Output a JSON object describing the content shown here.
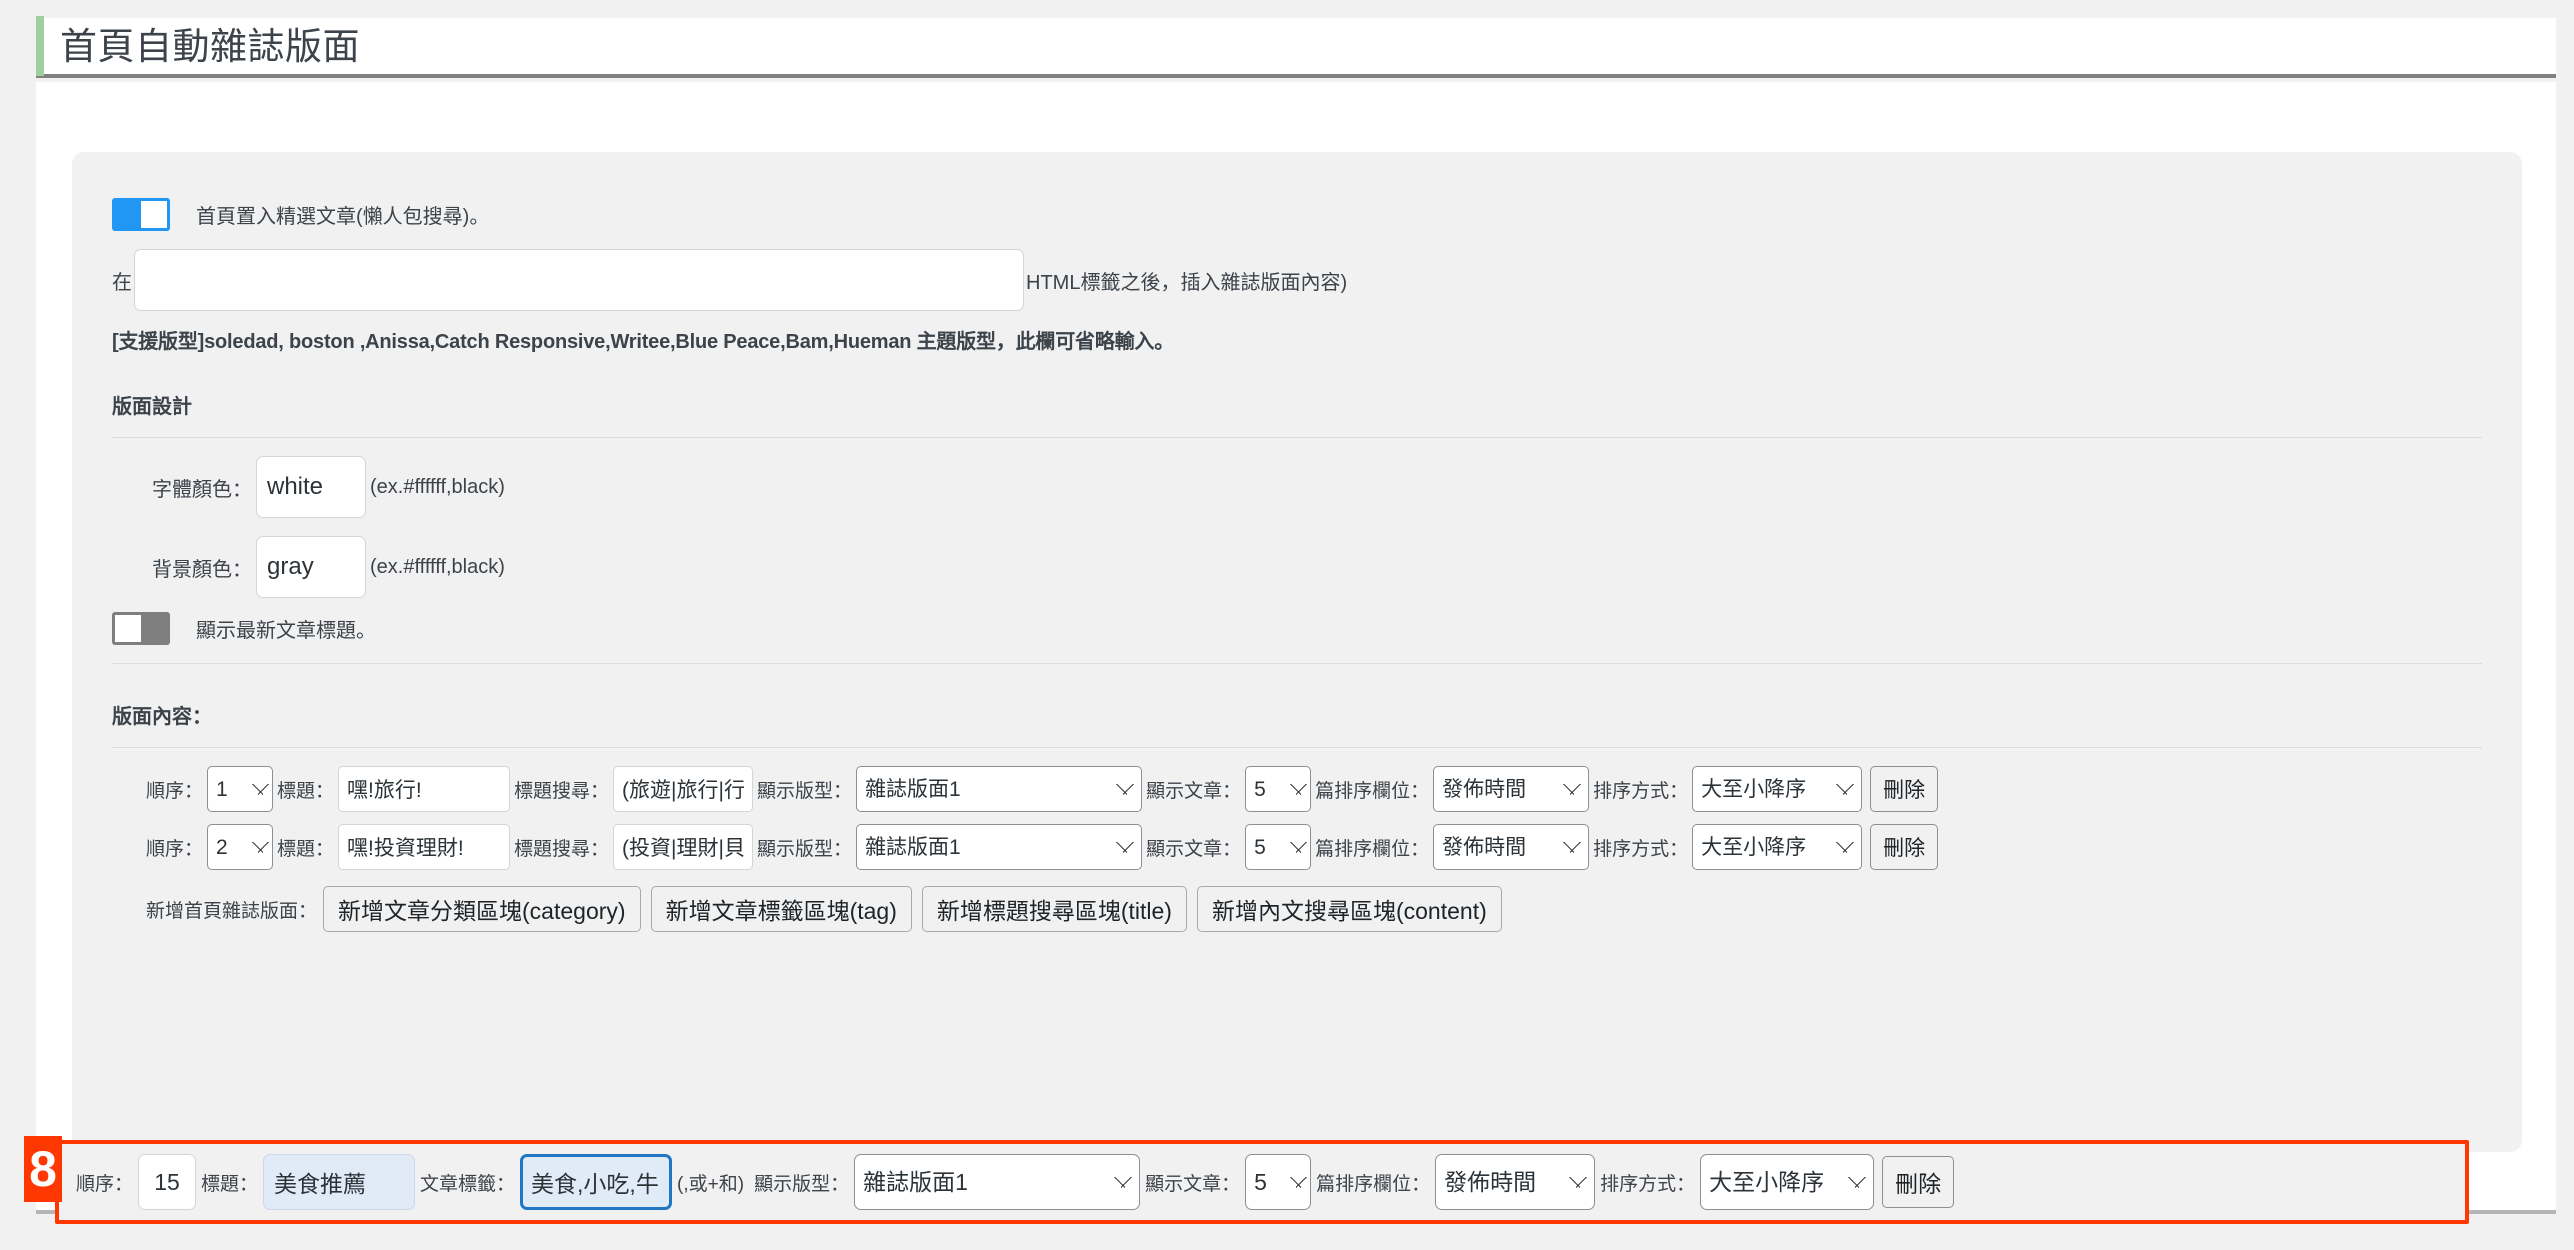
{
  "header": {
    "title": "首頁自動雜誌版面",
    "accent_color": "#9ed09e"
  },
  "featured": {
    "toggle_state": "on",
    "toggle_color": "#2196f3",
    "label": "首頁置入精選文章(懶人包搜尋)。",
    "prefix_text": "在",
    "html_tag_value": "",
    "html_tag_placeholder": "",
    "suffix_text": "HTML標籤之後，插入雜誌版面內容)",
    "support_note": "[支援版型]soledad, boston ,Anissa,Catch Responsive,Writee,Blue Peace,Bam,Hueman 主題版型，此欄可省略輸入。"
  },
  "design": {
    "heading": "版面設計",
    "font_color_label": "字體顏色：",
    "font_color_value": "white",
    "font_color_hint": "(ex.#ffffff,black)",
    "bg_color_label": "背景顏色：",
    "bg_color_value": "gray",
    "bg_color_hint": "(ex.#ffffff,black)",
    "latest_title_toggle_state": "off",
    "latest_title_toggle_color": "#7f7f7f",
    "latest_title_label": "顯示最新文章標題。"
  },
  "content": {
    "heading": "版面內容：",
    "labels": {
      "order": "順序：",
      "title": "標題：",
      "title_search": "標題搜尋：",
      "article_tag": "文章標籤：",
      "tag_hint": "(,或+和)",
      "layout": "顯示版型：",
      "show_posts": "顯示文章：",
      "sort_field": "篇排序欄位：",
      "sort_dir": "排序方式：",
      "delete": "刪除"
    },
    "rows": [
      {
        "order": "1",
        "title": "嘿!旅行!",
        "search_label": "標題搜尋：",
        "search": "(旅遊|旅行|行",
        "layout": "雜誌版面1",
        "show_posts": "5",
        "sort_field": "發佈時間",
        "sort_dir": "大至小降序",
        "delete": "刪除"
      },
      {
        "order": "2",
        "title": "嘿!投資理財!",
        "search_label": "標題搜尋：",
        "search": "(投資|理財|貝",
        "layout": "雜誌版面1",
        "show_posts": "5",
        "sort_field": "發佈時間",
        "sort_dir": "大至小降序",
        "delete": "刪除"
      }
    ],
    "add_label": "新增首頁雜誌版面：",
    "add_buttons": [
      "新增文章分類區塊(category)",
      "新增文章標籤區塊(tag)",
      "新增標題搜尋區塊(title)",
      "新增內文搜尋區塊(content)"
    ]
  },
  "highlighted_row": {
    "badge": "8",
    "badge_color": "#ff3700",
    "border_color": "#ff3700",
    "focus_color": "#1e76c4",
    "order_label": "順序：",
    "order": "15",
    "title_label": "標題：",
    "title": "美食推薦",
    "tag_label": "文章標籤：",
    "tag": "美食,小吃,牛",
    "tag_hint": "(,或+和)",
    "layout_label": "顯示版型：",
    "layout": "雜誌版面1",
    "show_posts_label": "顯示文章：",
    "show_posts": "5",
    "sort_field_label": "篇排序欄位：",
    "sort_field": "發佈時間",
    "sort_dir_label": "排序方式：",
    "sort_dir": "大至小降序",
    "delete": "刪除"
  },
  "options": {
    "order": [
      "1",
      "2",
      "15"
    ],
    "layout": [
      "雜誌版面1"
    ],
    "show_posts": [
      "5"
    ],
    "sort_field": [
      "發佈時間"
    ],
    "sort_dir": [
      "大至小降序"
    ]
  }
}
